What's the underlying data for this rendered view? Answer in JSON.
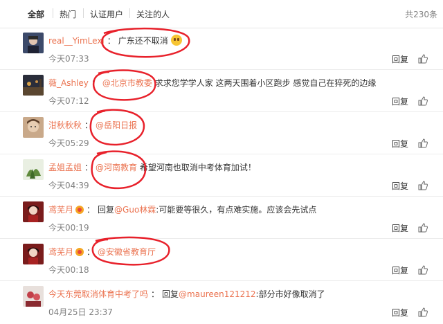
{
  "tabs": [
    {
      "label": "全部",
      "active": true
    },
    {
      "label": "热门",
      "active": false
    },
    {
      "label": "认证用户",
      "active": false
    },
    {
      "label": "关注的人",
      "active": false
    }
  ],
  "total": "共230条",
  "comments": [
    {
      "user": "real__YimLexi",
      "colon": "：",
      "mention": "",
      "text": "广东还不取消",
      "emoji": "thinking-emoji",
      "time": "今天07:33",
      "reply": "回复",
      "vip": false
    },
    {
      "user": "薇_Ashley",
      "colon": "：",
      "mention": "@北京市教委",
      "text": " 求求您学学人家 这两天围着小区跑步 感觉自己在猝死的边缘",
      "time": "今天07:12",
      "reply": "回复",
      "vip": false
    },
    {
      "user": "泔秋秋秋",
      "colon": "：",
      "mention": "@岳阳日报",
      "text": "",
      "time": "今天05:29",
      "reply": "回复",
      "vip": false
    },
    {
      "user": "孟姐孟姐",
      "colon": "：",
      "mention": "@河南教育",
      "text": " 希望河南也取消中考体育加试！",
      "time": "今天04:39",
      "reply": "回复",
      "vip": false
    },
    {
      "user": "鸢芜月",
      "colon": "：",
      "prefix": "回复",
      "mention": "@Guo林霖",
      "text": ":可能要等很久，有点难实施。应该会先试点",
      "time": "今天00:19",
      "reply": "回复",
      "vip": true
    },
    {
      "user": "鸢芜月",
      "colon": "：",
      "mention": "@安徽省教育厅",
      "text": "",
      "time": "今天00:18",
      "reply": "回复",
      "vip": true
    },
    {
      "user": "今天东莞取消体育中考了吗",
      "colon": "：",
      "prefix": "回复",
      "mention": "@maureen121212",
      "text": ":部分市好像取消了",
      "time": "04月25日 23:37",
      "reply": "回复",
      "vip": false
    }
  ],
  "colors": {
    "accent": "#eb7350",
    "annotation": "#e8212b"
  }
}
